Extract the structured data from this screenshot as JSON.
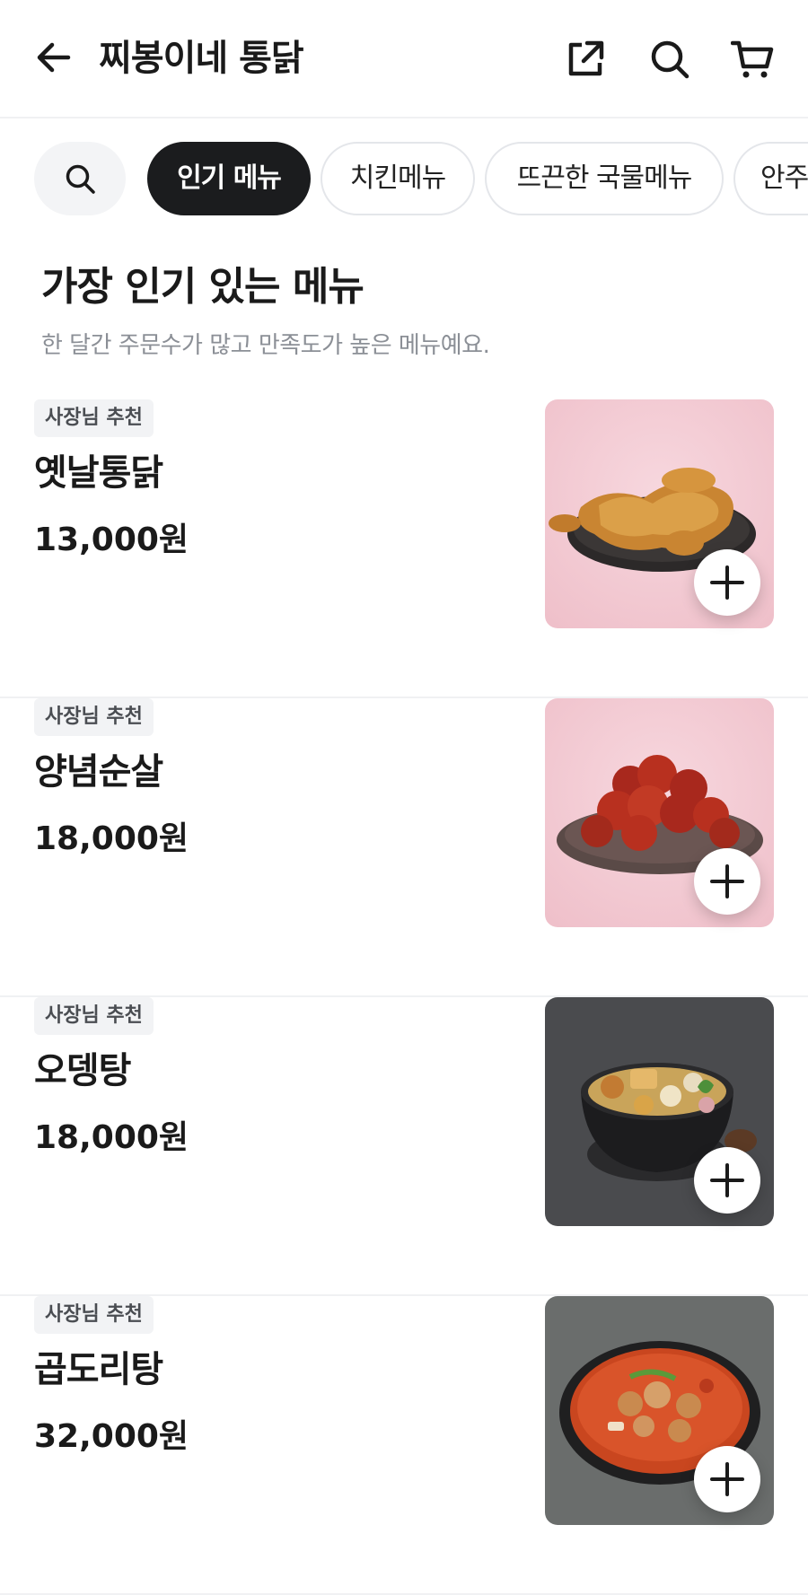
{
  "header": {
    "title": "찌봉이네 통닭",
    "back_icon": "arrow-left-icon",
    "share_icon": "share-icon",
    "search_icon": "search-icon",
    "cart_icon": "cart-icon"
  },
  "category_chips": {
    "search_icon": "search-icon",
    "items": [
      "인기 메뉴",
      "치킨메뉴",
      "뜨끈한 국물메뉴",
      "안주"
    ],
    "active_index": 0
  },
  "section": {
    "title": "가장 인기 있는 메뉴",
    "description": "한 달간 주문수가 많고 만족도가 높은 메뉴예요."
  },
  "menu_items": [
    {
      "badge": "사장님 추천",
      "name": "옛날통닭",
      "price": "13,000원",
      "image": "fried-chicken-plate"
    },
    {
      "badge": "사장님 추천",
      "name": "양념순살",
      "price": "18,000원",
      "image": "seasoned-boneless-chicken"
    },
    {
      "badge": "사장님 추천",
      "name": "오뎅탕",
      "price": "18,000원",
      "image": "fish-cake-soup"
    },
    {
      "badge": "사장님 추천",
      "name": "곱도리탕",
      "price": "32,000원",
      "image": "spicy-braised-chicken-stew"
    }
  ],
  "colors": {
    "active_chip": "#1b1c1e",
    "text_primary": "#1a1a1a",
    "text_secondary": "#8b8f96",
    "badge_bg": "#f2f3f5"
  }
}
